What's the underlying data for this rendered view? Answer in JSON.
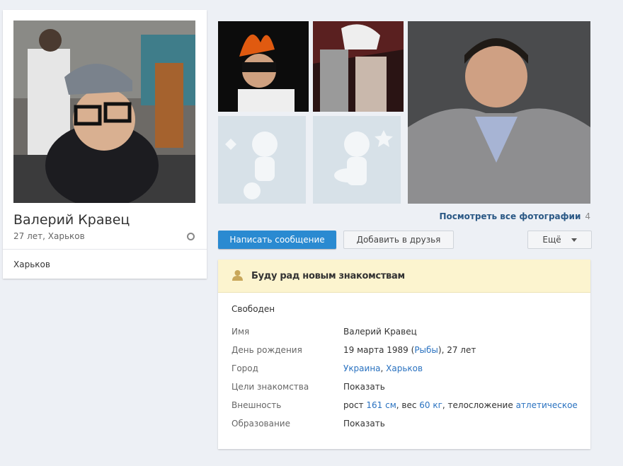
{
  "profile": {
    "name": "Валерий Кравец",
    "subtitle": "27 лет, Харьков",
    "city": "Харьков",
    "main_photo_icon": "profile-photo-icon"
  },
  "gallery": {
    "link_label": "Посмотреть все фотографии",
    "count": "4"
  },
  "actions": {
    "message": "Написать сообщение",
    "add_friend": "Добавить в друзья",
    "more": "Ещё"
  },
  "status": {
    "text": "Буду рад новым знакомствам",
    "icon": "user-icon"
  },
  "info": {
    "marital": "Свободен",
    "name_label": "Имя",
    "name_value": "Валерий Кравец",
    "birthday_label": "День рождения",
    "birthday_date": "19 марта 1989",
    "birthday_open": " (",
    "zodiac": "Рыбы",
    "birthday_close": "), 27 лет",
    "city_label": "Город",
    "country": "Украина",
    "city_sep": ", ",
    "city_value": "Харьков",
    "goals_label": "Цели знакомства",
    "goals_value": "Показать",
    "appearance_label": "Внешность",
    "height_prefix": "рост ",
    "height": "161 см",
    "weight_prefix": ", вес ",
    "weight": "60 кг",
    "build_prefix": ", телосложение ",
    "build": "атлетическое",
    "education_label": "Образование",
    "education_value": "Показать"
  },
  "colors": {
    "primary": "#2a8ad1",
    "link": "#2a72c0",
    "status_bg": "#fcf4cf",
    "page_bg": "#edf0f5"
  }
}
